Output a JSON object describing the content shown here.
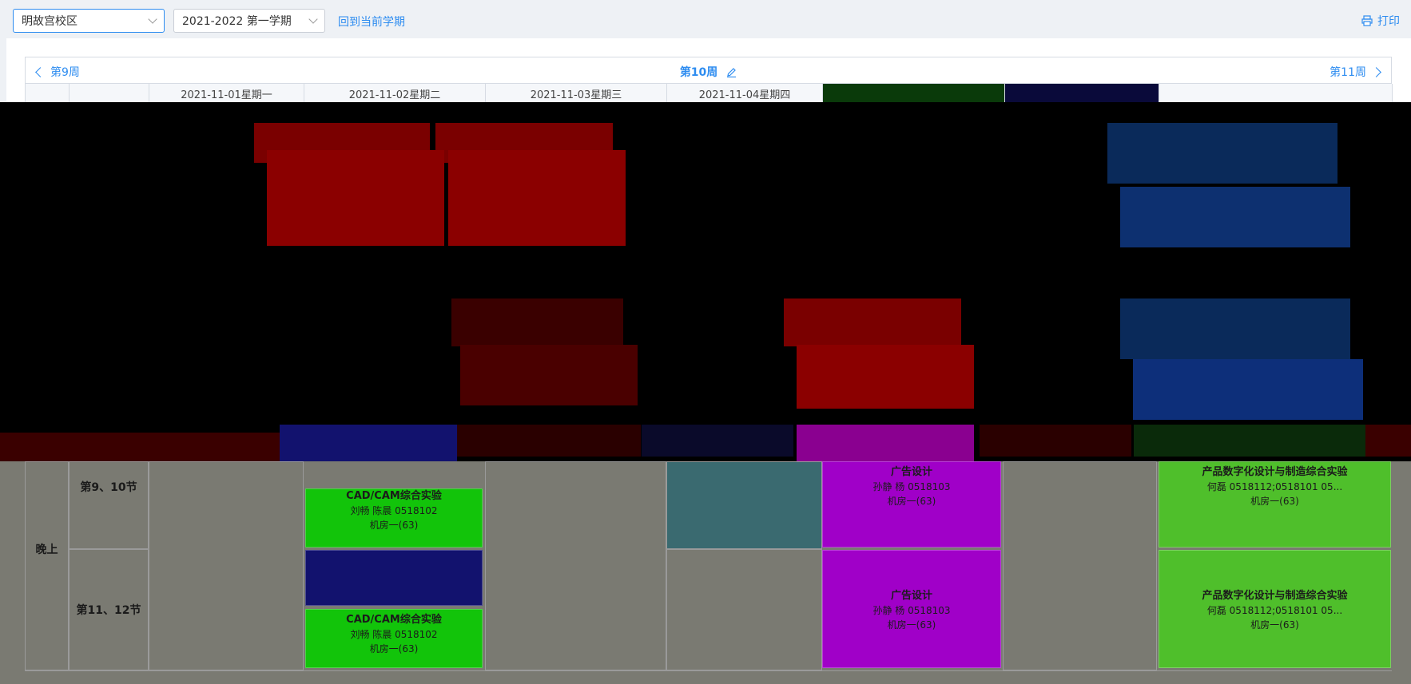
{
  "toolbar": {
    "campus": "明故宫校区",
    "term": "2021-2022 第一学期",
    "back_label": "回到当前学期",
    "print_label": "打印"
  },
  "week_nav": {
    "prev": "第9周",
    "current": "第10周",
    "next": "第11周"
  },
  "headers": {
    "days": [
      "2021-11-01星期一",
      "2021-11-02星期二",
      "2021-11-03星期三",
      "2021-11-04星期四"
    ]
  },
  "evening": {
    "period_label": "晚上",
    "slots": [
      "第9、10节",
      "第11、12节"
    ]
  },
  "courses": {
    "cam1": {
      "title": "CAD/CAM综合实验",
      "teacher": "刘畅 陈晨 0518102",
      "room": "机房一(63)"
    },
    "cam2": {
      "title": "CAD/CAM综合实验",
      "teacher": "刘畅 陈晨 0518102",
      "room": "机房一(63)"
    },
    "product1": {
      "title": "产品数字化设计与制造综合实验",
      "teacher": "何磊 0518112;0518101 05...",
      "room": "机房一(63)"
    },
    "product2": {
      "title": "产品数字化设计与制造综合实验",
      "teacher": "何磊 0518112;0518101 05...",
      "room": "机房一(63)"
    },
    "purple1": {
      "title": "广告设计",
      "teacher": "孙静 杨 0518103",
      "room": "机房一(63)"
    },
    "purple2": {
      "title": "广告设计",
      "teacher": "孙静 杨 0518103",
      "room": "机房一(63)"
    }
  },
  "colors": {
    "accent": "#2d8cf0",
    "red": "#8b0000",
    "blue": "#1b3f8a",
    "green": "#12c40a",
    "purple": "#a000c8",
    "teal": "#3a6a70",
    "light_green": "#4fbf2b",
    "navy": "#12126e"
  }
}
